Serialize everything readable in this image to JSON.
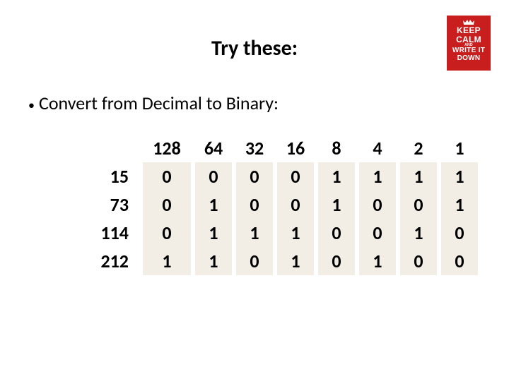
{
  "title": "Try these:",
  "bullet": "Convert from Decimal to Binary:",
  "badge": {
    "keep": "KEEP",
    "calm": "CALM",
    "and": "AND",
    "write": "WRITE IT",
    "down": "DOWN"
  },
  "chart_data": {
    "type": "table",
    "headers": [
      "128",
      "64",
      "32",
      "16",
      "8",
      "4",
      "2",
      "1"
    ],
    "rows": [
      {
        "label": "15",
        "cells": [
          "0",
          "0",
          "0",
          "0",
          "1",
          "1",
          "1",
          "1"
        ]
      },
      {
        "label": "73",
        "cells": [
          "0",
          "1",
          "0",
          "0",
          "1",
          "0",
          "0",
          "1"
        ]
      },
      {
        "label": "114",
        "cells": [
          "0",
          "1",
          "1",
          "1",
          "0",
          "0",
          "1",
          "0"
        ]
      },
      {
        "label": "212",
        "cells": [
          "1",
          "1",
          "0",
          "1",
          "0",
          "1",
          "0",
          "0"
        ]
      }
    ]
  }
}
